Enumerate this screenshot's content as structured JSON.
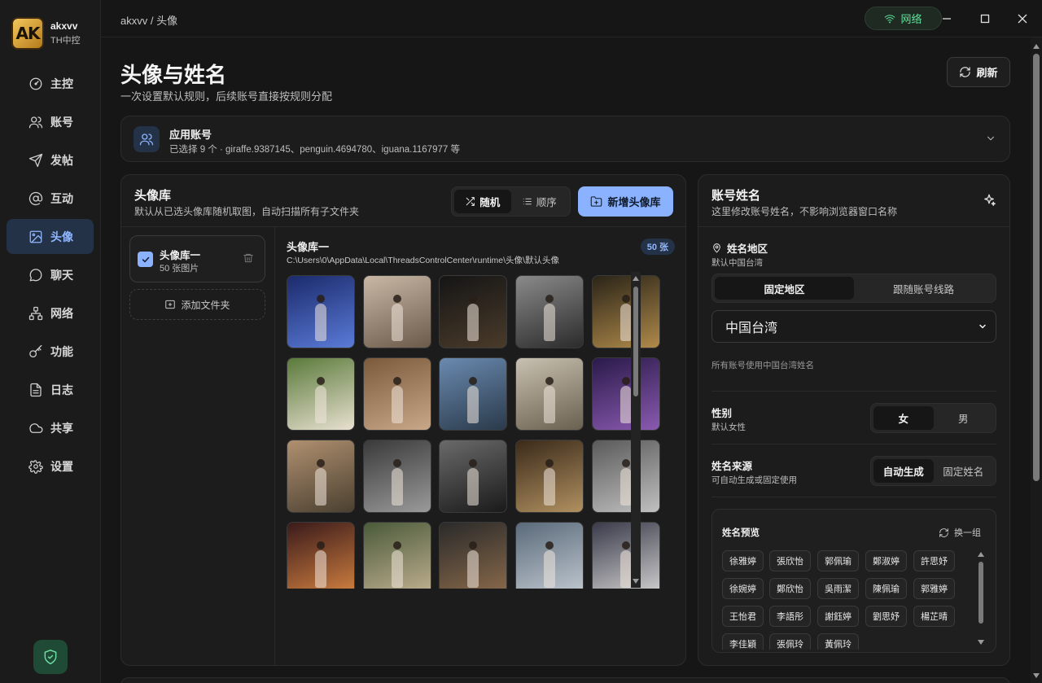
{
  "app": {
    "logo_text": "AK",
    "name": "akxvv",
    "subtitle": "TH中控"
  },
  "nav": {
    "items": [
      {
        "label": "主控",
        "icon": "gauge-icon"
      },
      {
        "label": "账号",
        "icon": "users-icon"
      },
      {
        "label": "发帖",
        "icon": "send-icon"
      },
      {
        "label": "互动",
        "icon": "at-icon"
      },
      {
        "label": "头像",
        "icon": "image-icon",
        "active": true
      },
      {
        "label": "聊天",
        "icon": "chat-icon"
      },
      {
        "label": "网络",
        "icon": "network-icon"
      },
      {
        "label": "功能",
        "icon": "key-icon"
      },
      {
        "label": "日志",
        "icon": "document-icon"
      },
      {
        "label": "共享",
        "icon": "cloud-icon"
      },
      {
        "label": "设置",
        "icon": "gear-icon"
      }
    ]
  },
  "titlebar": {
    "breadcrumb": "akxvv / 头像",
    "network_label": "网络"
  },
  "page": {
    "title": "头像与姓名",
    "subtitle": "一次设置默认规则，后续账号直接按规则分配",
    "refresh_label": "刷新"
  },
  "accounts": {
    "title": "应用账号",
    "desc": "已选择 9 个 · giraffe.9387145、penguin.4694780、iguana.1167977 等"
  },
  "library": {
    "title": "头像库",
    "desc": "默认从已选头像库随机取图，自动扫描所有子文件夹",
    "mode_random": "随机",
    "mode_order": "顺序",
    "active_mode": "random",
    "add_label": "新增头像库",
    "items": [
      {
        "name": "头像库一",
        "count": "50 张图片",
        "checked": true
      }
    ],
    "add_folder_label": "添加文件夹",
    "gallery": {
      "title": "头像库一",
      "path": "C:\\Users\\0\\AppData\\Local\\ThreadsControlCenter\\runtime\\头像\\默认头像",
      "badge": "50 张"
    }
  },
  "names": {
    "title": "账号姓名",
    "desc": "这里修改账号姓名，不影响浏览器窗口名称",
    "region": {
      "label": "姓名地区",
      "sub": "默认中国台湾",
      "opt_fixed": "固定地区",
      "opt_follow": "跟随账号线路",
      "active": "fixed",
      "selected": "中国台湾",
      "note": "所有账号使用中国台湾姓名"
    },
    "gender": {
      "label": "性别",
      "sub": "默认女性",
      "opt_female": "女",
      "opt_male": "男",
      "active": "female"
    },
    "source": {
      "label": "姓名来源",
      "sub": "可自动生成或固定使用",
      "opt_auto": "自动生成",
      "opt_fixed": "固定姓名",
      "active": "auto"
    },
    "preview": {
      "title": "姓名预览",
      "swap_label": "换一组",
      "rows": [
        [
          "徐雅婷",
          "張欣怡",
          "郭佩瑜",
          "鄭淑婷",
          "許思妤"
        ],
        [
          "徐婉婷",
          "鄭欣怡",
          "吳雨潔",
          "陳佩瑜",
          "郭雅婷"
        ],
        [
          "王怡君",
          "李語彤",
          "謝鈺婷",
          "劉思妤",
          "楊芷晴"
        ],
        [
          "李佳穎",
          "張佩玲",
          "黃佩玲"
        ]
      ]
    }
  }
}
